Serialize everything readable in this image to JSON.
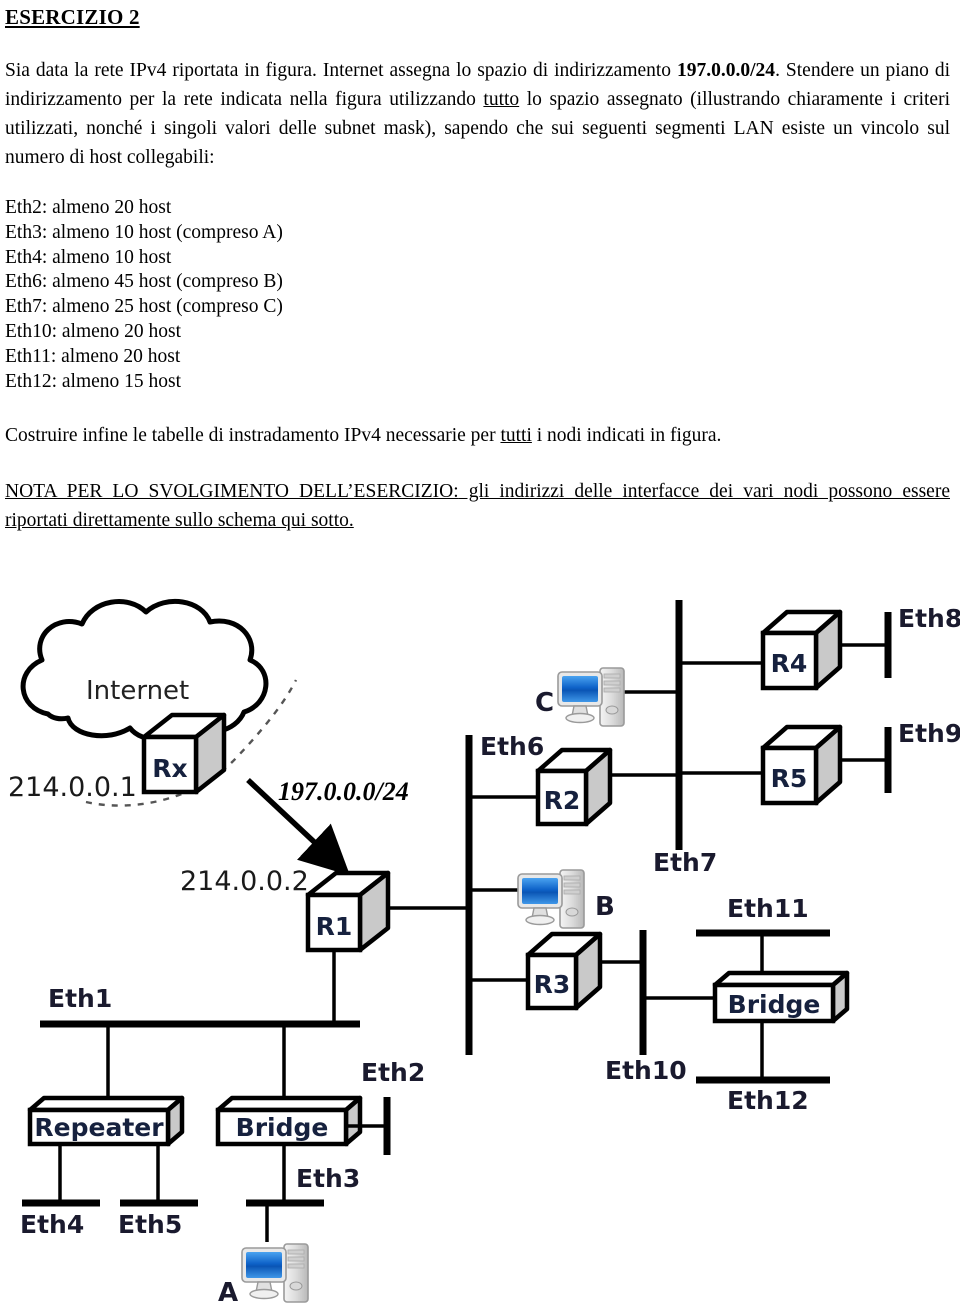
{
  "document": {
    "title": "ESERCIZIO 2",
    "intro": {
      "part1": "Sia data la rete IPv4 riportata in figura. Internet assegna lo spazio di indirizzamento ",
      "address_space": "197.0.0.0/24",
      "part2": ". Stendere un piano di indirizzamento per la rete indicata nella figura utilizzando ",
      "emphasis1": "tutto",
      "part3": " lo spazio assegnato (illustrando chiaramente i criteri utilizzati, nonché i singoli valori delle subnet mask), sapendo che sui seguenti segmenti LAN esiste un vincolo sul numero di host collegabili:"
    },
    "constraints": [
      "Eth2: almeno 20 host",
      "Eth3: almeno 10 host (compreso A)",
      "Eth4: almeno 10 host",
      "Eth6: almeno 45 host (compreso B)",
      "Eth7: almeno 25 host (compreso C)",
      "Eth10: almeno 20 host",
      "Eth11: almeno 20 host",
      "Eth12: almeno 15 host"
    ],
    "closing": {
      "part1": "Costruire infine le tabelle di instradamento IPv4 necessarie per ",
      "emphasis": "tutti",
      "part2": " i nodi indicati in figura."
    },
    "note": {
      "heading": "NOTA PER LO SVOLGIMENTO DELL’ESERCIZIO:",
      "body": " gli indirizzi delle interfacce dei vari nodi possono essere riportati direttamente sullo schema qui sotto."
    }
  },
  "diagram": {
    "cloud_label": "Internet",
    "routers": [
      {
        "id": "rx",
        "label": "Rx"
      },
      {
        "id": "r1",
        "label": "R1"
      },
      {
        "id": "r2",
        "label": "R2"
      },
      {
        "id": "r3",
        "label": "R3"
      },
      {
        "id": "r4",
        "label": "R4"
      },
      {
        "id": "r5",
        "label": "R5"
      }
    ],
    "devices": [
      {
        "id": "repeater",
        "label": "Repeater"
      },
      {
        "id": "bridge-left",
        "label": "Bridge"
      },
      {
        "id": "bridge-right",
        "label": "Bridge"
      }
    ],
    "hosts": [
      {
        "id": "host-a",
        "label": "A"
      },
      {
        "id": "host-b",
        "label": "B"
      },
      {
        "id": "host-c",
        "label": "C"
      }
    ],
    "addresses": [
      {
        "id": "addr-rx",
        "value": "214.0.0.1"
      },
      {
        "id": "addr-r1",
        "value": "214.0.0.2"
      }
    ],
    "network_label": "197.0.0.0/24",
    "segments": [
      {
        "id": "eth1",
        "label": "Eth1"
      },
      {
        "id": "eth2",
        "label": "Eth2"
      },
      {
        "id": "eth3",
        "label": "Eth3"
      },
      {
        "id": "eth4",
        "label": "Eth4"
      },
      {
        "id": "eth5",
        "label": "Eth5"
      },
      {
        "id": "eth6",
        "label": "Eth6"
      },
      {
        "id": "eth7",
        "label": "Eth7"
      },
      {
        "id": "eth8",
        "label": "Eth8"
      },
      {
        "id": "eth9",
        "label": "Eth9"
      },
      {
        "id": "eth10",
        "label": "Eth10"
      },
      {
        "id": "eth11",
        "label": "Eth11"
      },
      {
        "id": "eth12",
        "label": "Eth12"
      }
    ],
    "colors": {
      "line": "#000000",
      "router_face": "#ffffff",
      "router_side": "#c9c9c9",
      "screen": "#1b6fd4",
      "text": "#16213e"
    }
  }
}
